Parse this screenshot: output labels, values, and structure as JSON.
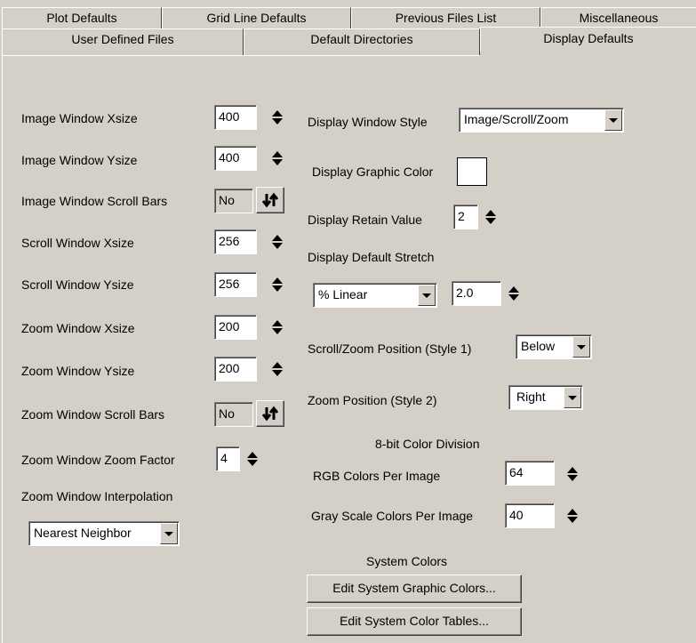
{
  "tabs_row1": [
    "Plot Defaults",
    "Grid Line Defaults",
    "Previous Files List",
    "Miscellaneous"
  ],
  "tabs_row2": [
    "User Defined Files",
    "Default Directories",
    "Display Defaults"
  ],
  "left": {
    "image_xsize": {
      "label": "Image Window Xsize",
      "value": "400"
    },
    "image_ysize": {
      "label": "Image Window Ysize",
      "value": "400"
    },
    "image_scroll_bars": {
      "label": "Image Window Scroll Bars",
      "value": "No"
    },
    "scroll_xsize": {
      "label": "Scroll Window Xsize",
      "value": "256"
    },
    "scroll_ysize": {
      "label": "Scroll Window Ysize",
      "value": "256"
    },
    "zoom_xsize": {
      "label": "Zoom Window Xsize",
      "value": "200"
    },
    "zoom_ysize": {
      "label": "Zoom Window Ysize",
      "value": "200"
    },
    "zoom_scroll_bars": {
      "label": "Zoom Window Scroll Bars",
      "value": "No"
    },
    "zoom_factor": {
      "label": "Zoom Window Zoom Factor",
      "value": "4"
    },
    "zoom_interp": {
      "label": "Zoom Window Interpolation",
      "value": "Nearest Neighbor"
    }
  },
  "right": {
    "window_style": {
      "label": "Display Window Style",
      "value": "Image/Scroll/Zoom"
    },
    "graphic_color": {
      "label": "Display Graphic Color",
      "color": "#ffffff"
    },
    "retain_value": {
      "label": "Display Retain Value",
      "value": "2"
    },
    "default_stretch": {
      "label": "Display Default Stretch",
      "type": "% Linear",
      "value": "2.0"
    },
    "scroll_zoom_position": {
      "label": "Scroll/Zoom Position (Style 1)",
      "value": "Below"
    },
    "zoom_position": {
      "label": "Zoom Position (Style 2)",
      "value": "Right"
    },
    "color_division_heading": "8-bit Color Division",
    "rgb_colors": {
      "label": "RGB Colors Per Image",
      "value": "64"
    },
    "gray_colors": {
      "label": "Gray Scale Colors Per Image",
      "value": "40"
    },
    "system_colors_heading": "System Colors",
    "edit_graphic_colors": "Edit System Graphic Colors...",
    "edit_color_tables": "Edit System Color Tables..."
  },
  "icons": {
    "spinner": "up-down-arrows-icon",
    "toggle": "swap-arrows-icon",
    "dropdown": "chevron-down-icon"
  }
}
